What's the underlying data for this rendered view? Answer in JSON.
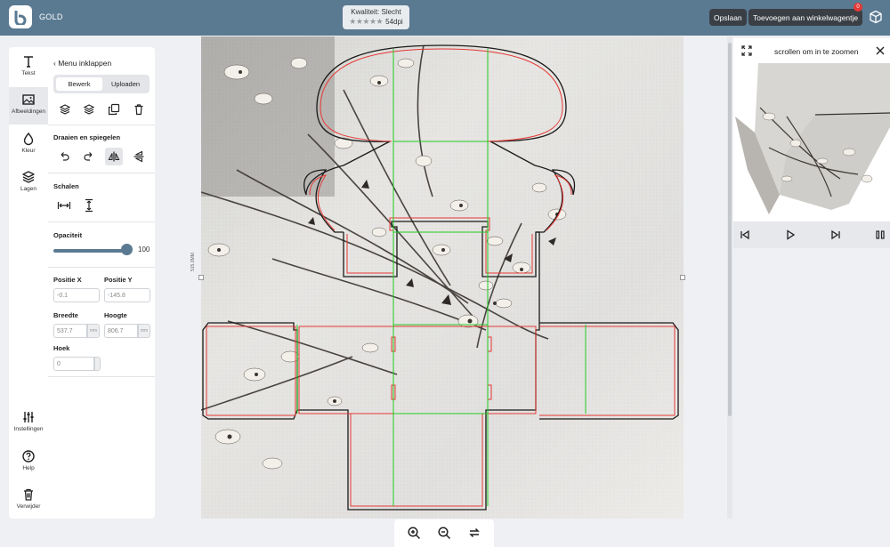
{
  "topbar": {
    "brand": "GOLD",
    "quality_label": "Kwaliteit: Slecht",
    "quality_stars": "★★★★★",
    "dpi": "54dpi",
    "save": "Opslaan",
    "add_to_cart": "Toevoegen aan winkelwagentje",
    "cart_count": "0"
  },
  "tools": {
    "text": "Tekst",
    "images": "Afbeeldingen",
    "color": "Kleur",
    "layers": "Lagen",
    "settings": "Instellingen",
    "help": "Help",
    "delete": "Verwijder"
  },
  "panel": {
    "collapse": "Menu inklappen",
    "tab_edit": "Bewerk",
    "tab_upload": "Uploaden",
    "rotate_flip": "Draaien en spiegelen",
    "scale": "Schalen",
    "opacity": "Opaciteit",
    "opacity_value": "100",
    "opacity_fraction": 1.0,
    "pos_x_label": "Positie X",
    "pos_y_label": "Positie Y",
    "pos_x": "-0.1",
    "pos_y": "-145.8",
    "width_label": "Breedte",
    "height_label": "Hoogte",
    "width": "537.7",
    "height": "806.7",
    "unit": "mm",
    "angle_label": "Hoek",
    "angle": "0"
  },
  "canvas": {
    "dimension_label": "515.2MM"
  },
  "preview": {
    "title": "scrollen om in te zoomen"
  },
  "colors": {
    "topbar": "#5a7a92",
    "accent": "#5a7a92",
    "cut_line": "#e53935",
    "fold_line": "#22cc22",
    "badge": "#e53935"
  }
}
